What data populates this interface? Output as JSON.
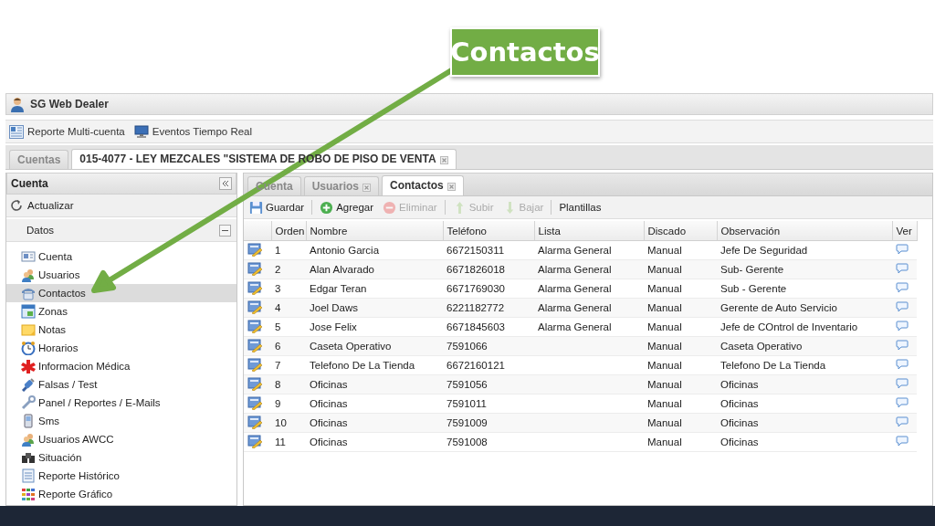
{
  "callout": {
    "label": "Contactos"
  },
  "window": {
    "title": "SG Web Dealer"
  },
  "toolbar": [
    {
      "label": "Reporte Multi-cuenta"
    },
    {
      "label": "Eventos Tiempo Real"
    }
  ],
  "account_tabs": [
    {
      "label": "Cuentas",
      "selected": false,
      "closable": false
    },
    {
      "label": "015-4077 - LEY MEZCALES \"SISTEMA DE ROBO DE PISO DE VENTA",
      "selected": true,
      "closable": true
    }
  ],
  "sidebar": {
    "title": "Cuenta",
    "refresh": "Actualizar",
    "section": "Datos",
    "items": [
      {
        "label": "Cuenta",
        "selected": false
      },
      {
        "label": "Usuarios",
        "selected": false
      },
      {
        "label": "Contactos",
        "selected": true
      },
      {
        "label": "Zonas",
        "selected": false
      },
      {
        "label": "Notas",
        "selected": false
      },
      {
        "label": "Horarios",
        "selected": false
      },
      {
        "label": "Informacion Médica",
        "selected": false
      },
      {
        "label": "Falsas / Test",
        "selected": false
      },
      {
        "label": "Panel / Reportes / E-Mails",
        "selected": false
      },
      {
        "label": "Sms",
        "selected": false
      },
      {
        "label": "Usuarios AWCC",
        "selected": false
      },
      {
        "label": "Situación",
        "selected": false
      },
      {
        "label": "Reporte Histórico",
        "selected": false
      },
      {
        "label": "Reporte Gráfico",
        "selected": false
      }
    ]
  },
  "content_tabs": [
    {
      "label": "Cuenta",
      "selected": false,
      "closable": false
    },
    {
      "label": "Usuarios",
      "selected": false,
      "closable": true
    },
    {
      "label": "Contactos",
      "selected": true,
      "closable": true
    }
  ],
  "actions": [
    {
      "label": "Guardar",
      "disabled": false
    },
    {
      "label": "Agregar",
      "disabled": false
    },
    {
      "label": "Eliminar",
      "disabled": true
    },
    {
      "label": "Subir",
      "disabled": true
    },
    {
      "label": "Bajar",
      "disabled": true
    },
    {
      "label": "Plantillas",
      "disabled": false
    }
  ],
  "table": {
    "columns": [
      "Orden",
      "Nombre",
      "Teléfono",
      "Lista",
      "Discado",
      "Observación",
      "Ver"
    ],
    "rows": [
      {
        "orden": "1",
        "nombre": "Antonio Garcia",
        "telefono": "6672150311",
        "lista": "Alarma General",
        "discado": "Manual",
        "observacion": "Jefe De Seguridad"
      },
      {
        "orden": "2",
        "nombre": "Alan Alvarado",
        "telefono": "6671826018",
        "lista": "Alarma General",
        "discado": "Manual",
        "observacion": "Sub- Gerente"
      },
      {
        "orden": "3",
        "nombre": "Edgar Teran",
        "telefono": "6671769030",
        "lista": "Alarma General",
        "discado": "Manual",
        "observacion": "Sub - Gerente"
      },
      {
        "orden": "4",
        "nombre": "Joel Daws",
        "telefono": "6221182772",
        "lista": "Alarma General",
        "discado": "Manual",
        "observacion": "Gerente de Auto Servicio"
      },
      {
        "orden": "5",
        "nombre": "Jose Felix",
        "telefono": "6671845603",
        "lista": "Alarma General",
        "discado": "Manual",
        "observacion": "Jefe de COntrol de Inventario"
      },
      {
        "orden": "6",
        "nombre": "Caseta Operativo",
        "telefono": "7591066",
        "discado": "Manual",
        "observacion": "Caseta Operativo"
      },
      {
        "orden": "7",
        "nombre": "Telefono De La Tienda",
        "telefono": "6672160121",
        "discado": "Manual",
        "observacion": "Telefono De La Tienda"
      },
      {
        "orden": "8",
        "nombre": "Oficinas",
        "telefono": "7591056",
        "discado": "Manual",
        "observacion": "Oficinas"
      },
      {
        "orden": "9",
        "nombre": "Oficinas",
        "telefono": "7591011",
        "discado": "Manual",
        "observacion": "Oficinas"
      },
      {
        "orden": "10",
        "nombre": "Oficinas",
        "telefono": "7591009",
        "discado": "Manual",
        "observacion": "Oficinas"
      },
      {
        "orden": "11",
        "nombre": "Oficinas",
        "telefono": "7591008",
        "discado": "Manual",
        "observacion": "Oficinas"
      }
    ]
  }
}
